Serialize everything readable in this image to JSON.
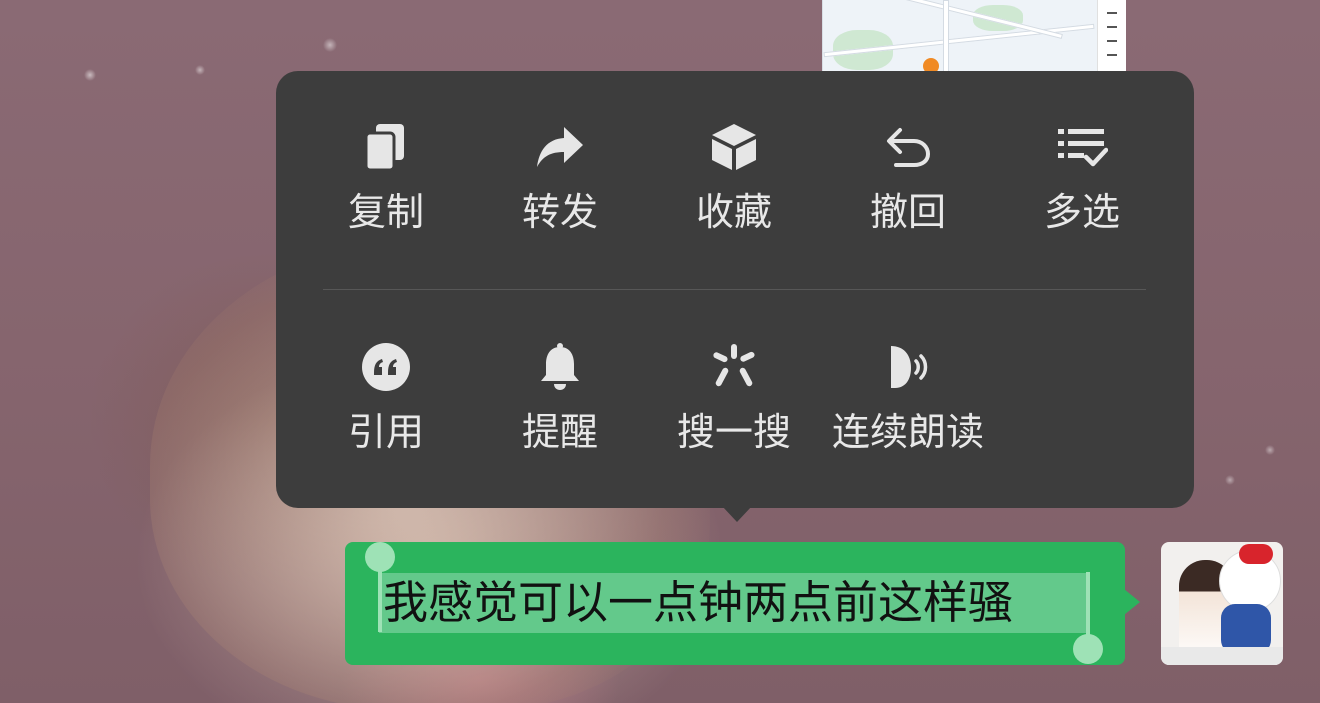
{
  "context_menu": {
    "row1": [
      {
        "label": "复制",
        "icon": "copy-icon"
      },
      {
        "label": "转发",
        "icon": "forward-icon"
      },
      {
        "label": "收藏",
        "icon": "favorite-box-icon"
      },
      {
        "label": "撤回",
        "icon": "undo-icon"
      },
      {
        "label": "多选",
        "icon": "multi-select-icon"
      }
    ],
    "row2": [
      {
        "label": "引用",
        "icon": "quote-icon"
      },
      {
        "label": "提醒",
        "icon": "bell-icon"
      },
      {
        "label": "搜一搜",
        "icon": "search-sparkle-icon"
      },
      {
        "label": "连续朗读",
        "icon": "read-aloud-icon"
      }
    ],
    "background_color": "#3d3d3d"
  },
  "message": {
    "text": "我感觉可以一点钟两点前这样骚",
    "bubble_color": "#2bb45d",
    "selection_color": "#63c98b"
  }
}
